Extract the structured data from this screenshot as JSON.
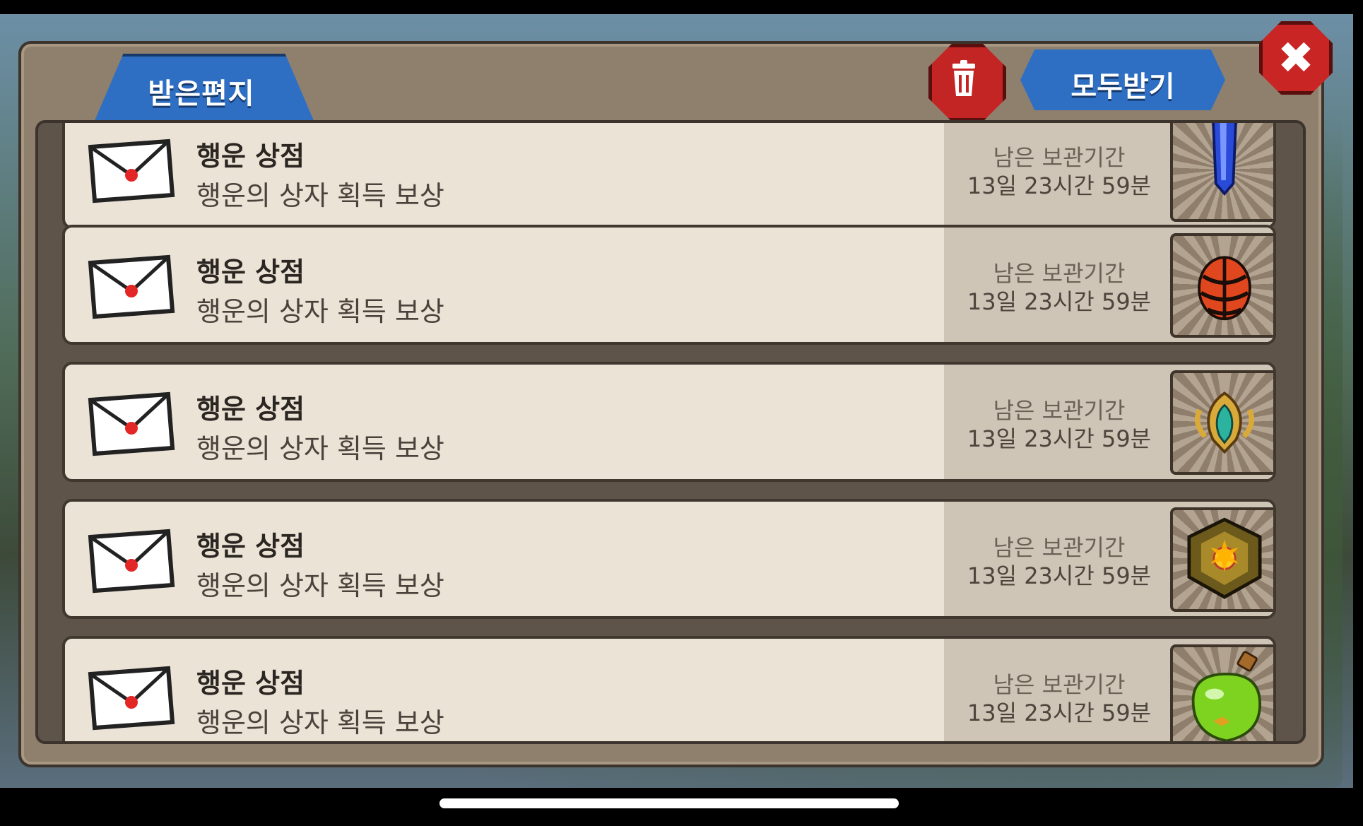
{
  "header": {
    "tab_label": "받은편지",
    "receive_all_label": "모두받기"
  },
  "mail_list": [
    {
      "sender": "행운 상점",
      "description": "행운의 상자 획득 보상",
      "expiry_label": "남은 보관기간",
      "expiry_value": "13일 23시간 59분",
      "reward_icon": "blue-crystal-shard-icon"
    },
    {
      "sender": "행운 상점",
      "description": "행운의 상자 획득 보상",
      "expiry_label": "남은 보관기간",
      "expiry_value": "13일 23시간 59분",
      "reward_icon": "red-dragon-egg-icon"
    },
    {
      "sender": "행운 상점",
      "description": "행운의 상자 획득 보상",
      "expiry_label": "남은 보관기간",
      "expiry_value": "13일 23시간 59분",
      "reward_icon": "golden-winged-emblem-icon"
    },
    {
      "sender": "행운 상점",
      "description": "행운의 상자 획득 보상",
      "expiry_label": "남은 보관기간",
      "expiry_value": "13일 23시간 59분",
      "reward_icon": "gold-sun-medal-icon"
    },
    {
      "sender": "행운 상점",
      "description": "행운의 상자 획득 보상",
      "expiry_label": "남은 보관기간",
      "expiry_value": "13일 23시간 59분",
      "reward_icon": "green-potion-flask-icon"
    }
  ],
  "colors": {
    "tab_blue": "#2e6fc4",
    "close_red": "#c92525",
    "row_bg": "#eae3d6",
    "panel_brown": "#8f7f6d"
  }
}
